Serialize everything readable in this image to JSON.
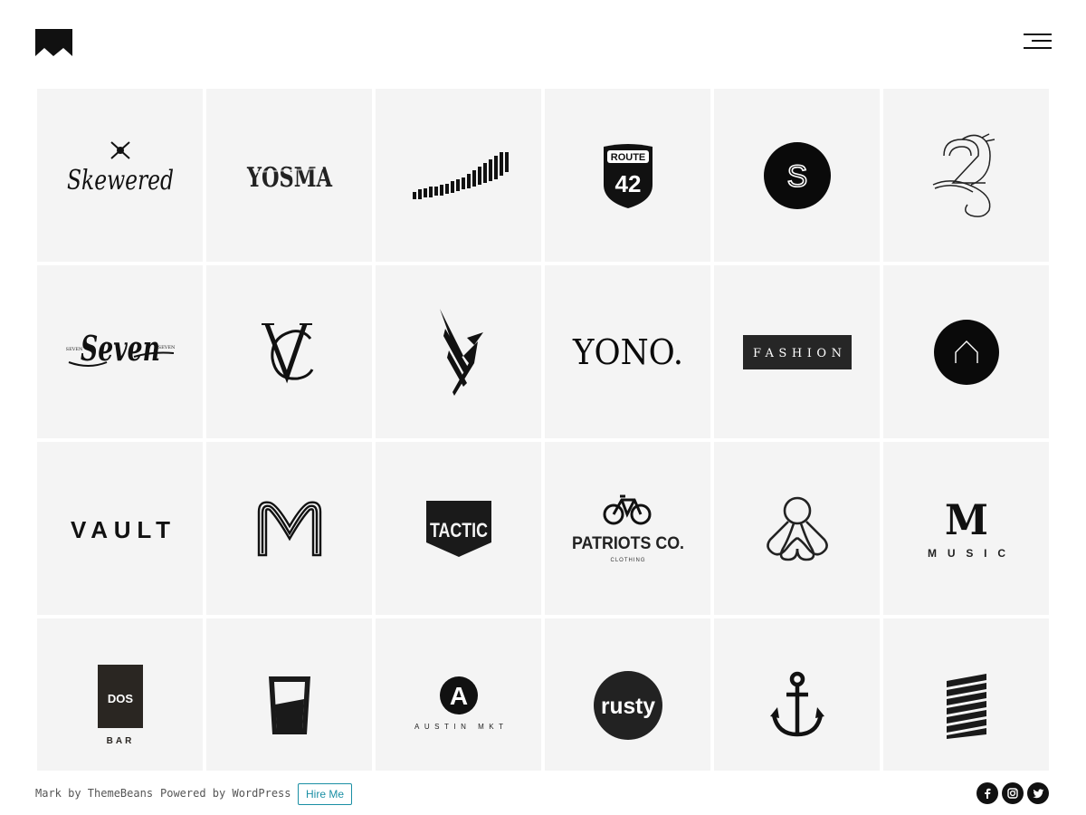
{
  "header": {
    "logo_icon": "mark-logo-icon",
    "menu_icon": "hamburger-menu-icon"
  },
  "portfolio": {
    "tiles": [
      {
        "name": "skewered",
        "text": "Skewered"
      },
      {
        "name": "yosma",
        "text": "YOSMA"
      },
      {
        "name": "wave-barcode",
        "text": ""
      },
      {
        "name": "route-42",
        "text": "ROUTE",
        "number": "42"
      },
      {
        "name": "s-circle",
        "text": "S"
      },
      {
        "name": "seahorse-monogram",
        "text": ""
      },
      {
        "name": "seven",
        "text": "Seven",
        "small_left": "SEVEN",
        "small_right": "SEVEN"
      },
      {
        "name": "vc-monogram",
        "text": "VC"
      },
      {
        "name": "bird-stripes",
        "text": ""
      },
      {
        "name": "yono",
        "text": "YONO."
      },
      {
        "name": "fashion",
        "text": "FASHION"
      },
      {
        "name": "house-circle",
        "text": ""
      },
      {
        "name": "vault",
        "text": "VAULT"
      },
      {
        "name": "m-outline",
        "text": "M"
      },
      {
        "name": "tactic",
        "text": "TACTIC"
      },
      {
        "name": "patriots-co",
        "text": "PATRIOTS CO.",
        "subtext": "CLOTHING"
      },
      {
        "name": "octopus",
        "text": ""
      },
      {
        "name": "m-music",
        "text": "M",
        "subtext": "MUSIC"
      },
      {
        "name": "dos-bar",
        "text": "DOS",
        "subtext": "BAR"
      },
      {
        "name": "glass",
        "text": ""
      },
      {
        "name": "austin-mkt",
        "text": "A",
        "subtext": "AUSTIN MKT"
      },
      {
        "name": "rusty",
        "text": "rusty"
      },
      {
        "name": "anchor",
        "text": ""
      },
      {
        "name": "striped-building",
        "text": ""
      }
    ]
  },
  "footer": {
    "credit_theme": "Mark by ThemeBeans",
    "credit_powered": "Powered by WordPress",
    "hire_label": "Hire Me",
    "social": [
      "facebook-icon",
      "instagram-icon",
      "twitter-icon"
    ]
  }
}
